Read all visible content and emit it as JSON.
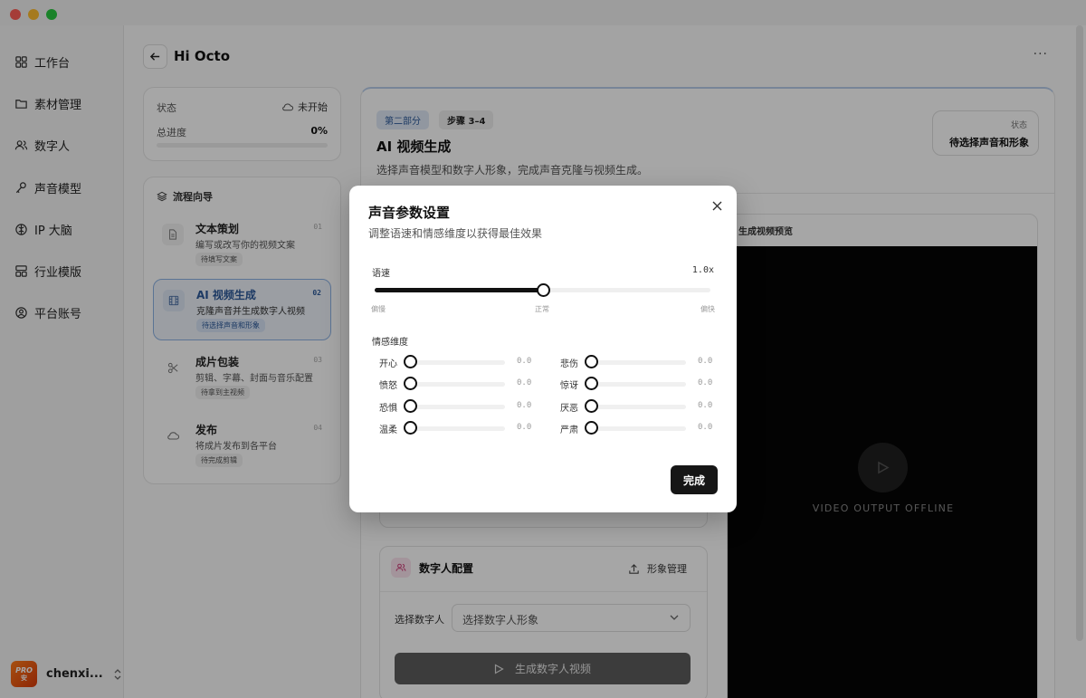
{
  "window": {
    "traffic_lights": [
      "#fe5f57",
      "#febc2e",
      "#28c840"
    ]
  },
  "sidebar": {
    "items": [
      {
        "icon": "grid-icon",
        "label": "工作台"
      },
      {
        "icon": "folder-icon",
        "label": "素材管理"
      },
      {
        "icon": "users-icon",
        "label": "数字人"
      },
      {
        "icon": "mic-icon",
        "label": "声音模型"
      },
      {
        "icon": "brain-icon",
        "label": "IP 大脑"
      },
      {
        "icon": "template-icon",
        "label": "行业模版"
      },
      {
        "icon": "account-icon",
        "label": "平台账号"
      }
    ],
    "user": {
      "avatar_line1": "PRO",
      "avatar_line2": "安",
      "name": "chenxi..."
    }
  },
  "header": {
    "title": "Hi Octo",
    "more": "···"
  },
  "status_card": {
    "status_label": "状态",
    "status_value": "未开始",
    "progress_label": "总进度",
    "progress_value": "0%",
    "progress": 0
  },
  "guide": {
    "title": "流程向导",
    "steps": [
      {
        "title": "文本策划",
        "desc": "编写或改写你的视频文案",
        "badge": "待填写文案",
        "num": "01"
      },
      {
        "title": "AI 视频生成",
        "desc": "克隆声音并生成数字人视频",
        "badge": "待选择声音和形象",
        "num": "02"
      },
      {
        "title": "成片包装",
        "desc": "剪辑、字幕、封面与音乐配置",
        "badge": "待拿到主视频",
        "num": "03"
      },
      {
        "title": "发布",
        "desc": "将成片发布到各平台",
        "badge": "待完成剪辑",
        "num": "04"
      }
    ]
  },
  "content": {
    "tag_part": "第二部分",
    "tag_step": "步骤 3–4",
    "title": "AI 视频生成",
    "subtitle": "选择声音模型和数字人形象，完成声音克隆与视频生成。",
    "status_label": "状态",
    "status_value": "待选择声音和形象",
    "preview_title": "生成视频预览",
    "preview_offline": "VIDEO OUTPUT OFFLINE",
    "digital_human": {
      "title": "数字人配置",
      "manage": "形象管理",
      "select_label": "选择数字人",
      "select_value": "选择数字人形象",
      "generate": "生成数字人视频"
    }
  },
  "modal": {
    "title": "声音参数设置",
    "subtitle": "调整语速和情感维度以获得最佳效果",
    "speed_label": "语速",
    "speed_value": "1.0x",
    "speed_fraction": 0.5,
    "speed_min": "偏慢",
    "speed_mid": "正常",
    "speed_max": "偏快",
    "emotion_title": "情感维度",
    "emotions_left": [
      {
        "label": "开心",
        "value": "0.0"
      },
      {
        "label": "愤怒",
        "value": "0.0"
      },
      {
        "label": "恐惧",
        "value": "0.0"
      },
      {
        "label": "温柔",
        "value": "0.0"
      }
    ],
    "emotions_right": [
      {
        "label": "悲伤",
        "value": "0.0"
      },
      {
        "label": "惊讶",
        "value": "0.0"
      },
      {
        "label": "厌恶",
        "value": "0.0"
      },
      {
        "label": "严肃",
        "value": "0.0"
      }
    ],
    "done": "完成"
  }
}
